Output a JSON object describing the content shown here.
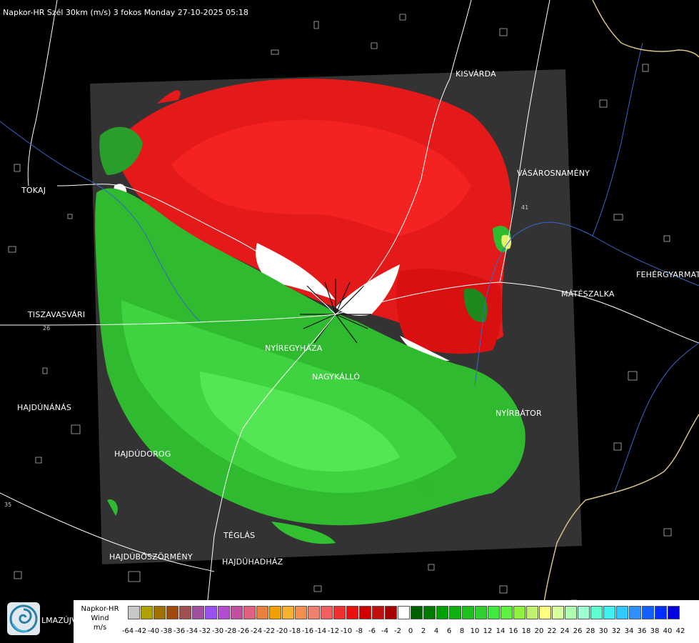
{
  "title": "Napkor-HR Szél 30km (m/s) 3 fokos Monday 27-10-2025 05:18",
  "cities": [
    {
      "name": "KISVÁRDA"
    },
    {
      "name": "TOKAJ"
    },
    {
      "name": "VÁSÁROSNAMÉNY"
    },
    {
      "name": "FEHÉRGYARMAT"
    },
    {
      "name": "MÁTÉSZALKA"
    },
    {
      "name": "TISZAVASVÁRI"
    },
    {
      "name": "NYÍREGYHÁZA"
    },
    {
      "name": "NAGYKÁLLÓ"
    },
    {
      "name": "HAJDÚNÁNÁS"
    },
    {
      "name": "NYÍRBÁTOR"
    },
    {
      "name": "HAJDÚDOROG"
    },
    {
      "name": "TÉGLÁS"
    },
    {
      "name": "HAJDÚBÖSZÖRMÉNY"
    },
    {
      "name": "HAJDÚHADHÁZ"
    }
  ],
  "partial_city": "LMAZÚJVÁR",
  "road_numbers": [
    "26",
    "35",
    "41"
  ],
  "legend": {
    "line1": "Napkor-HR",
    "line2": "Wind",
    "line3": "m/s",
    "ticks": [
      "-64",
      "-42",
      "-40",
      "-38",
      "-36",
      "-34",
      "-32",
      "-30",
      "-28",
      "-26",
      "-24",
      "-22",
      "-20",
      "-18",
      "-16",
      "-14",
      "-12",
      "-10",
      "-8",
      "-6",
      "-4",
      "-2",
      "0",
      "2",
      "4",
      "6",
      "8",
      "10",
      "12",
      "14",
      "16",
      "18",
      "20",
      "22",
      "24",
      "26",
      "28",
      "30",
      "32",
      "34",
      "36",
      "38",
      "40",
      "42"
    ],
    "colors": [
      "#c8c8c8",
      "#b0a000",
      "#a07000",
      "#a04a10",
      "#a05050",
      "#a050a0",
      "#9a50f0",
      "#b050d0",
      "#c050a0",
      "#e06080",
      "#e88040",
      "#f0a000",
      "#f8b030",
      "#f09050",
      "#f08070",
      "#f06060",
      "#f03030",
      "#e81010",
      "#d00000",
      "#c01010",
      "#a80000",
      "#ffffff",
      "#006000",
      "#007a00",
      "#00a000",
      "#10b010",
      "#20c020",
      "#30d030",
      "#40e840",
      "#60f040",
      "#90f040",
      "#c0f070",
      "#ffff80",
      "#d8ffa0",
      "#b0ffb0",
      "#a0ffd0",
      "#60ffd0",
      "#40f0f0",
      "#30c8ff",
      "#3090ff",
      "#1060ff",
      "#0030ff",
      "#0000e0"
    ]
  },
  "colors": {
    "background": "#000000",
    "radar_area": "#333333",
    "approach_wind": "#e81010",
    "receding_wind": "#30c030"
  }
}
